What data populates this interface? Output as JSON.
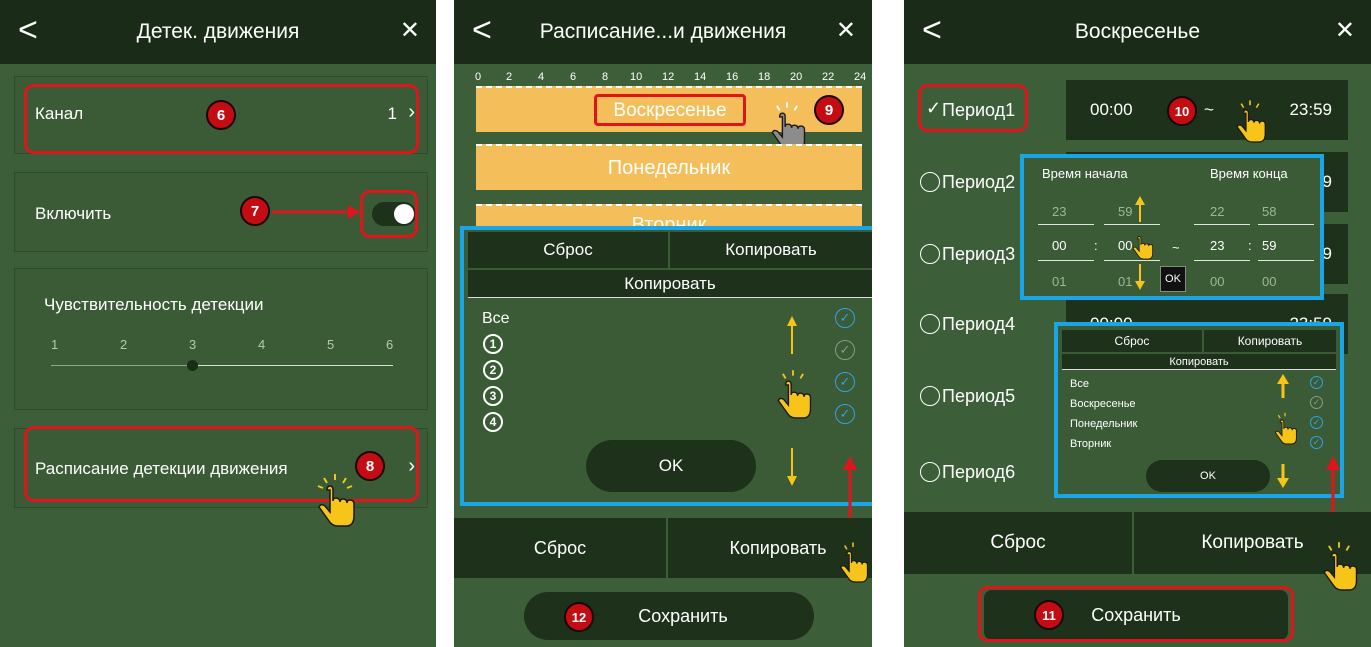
{
  "screen1": {
    "title": "Детек. движения",
    "channel_label": "Канал",
    "channel_value": "1",
    "enable_label": "Включить",
    "sensitivity_label": "Чувствительность детекции",
    "ticks": [
      "1",
      "2",
      "3",
      "4",
      "5",
      "6"
    ],
    "sensitivity": 3,
    "schedule_label": "Расписание детекции движения",
    "step6": "6",
    "step7": "7",
    "step8": "8"
  },
  "screen2": {
    "title": "Расписание...и движения",
    "hours": [
      "0",
      "2",
      "4",
      "6",
      "8",
      "10",
      "12",
      "14",
      "16",
      "18",
      "20",
      "22",
      "24"
    ],
    "days": [
      "Воскресенье",
      "Понедельник",
      "Вторник"
    ],
    "popup": {
      "reset": "Сброс",
      "copy": "Копировать",
      "header": "Копировать",
      "all": "Все",
      "items": [
        "1",
        "2",
        "3",
        "4"
      ],
      "ok": "OK"
    },
    "reset": "Сброс",
    "copy": "Копировать",
    "save": "Сохранить",
    "step9": "9",
    "step12": "12"
  },
  "screen3": {
    "title": "Воскресенье",
    "periods": [
      "Период1",
      "Период2",
      "Период3",
      "Период4",
      "Период5",
      "Период6"
    ],
    "p1_start": "00:00",
    "tilde": "~",
    "p1_end": "23:59",
    "partial": [
      "9",
      "9"
    ],
    "p4_partial_start": "00:00",
    "p4_partial_end": "23:59",
    "picker": {
      "start_label": "Время начала",
      "end_label": "Время конца",
      "rows": [
        [
          "23",
          "59",
          "22",
          "58"
        ],
        [
          "00",
          "00",
          "23",
          "59"
        ],
        [
          "01",
          "01",
          "00",
          "00"
        ]
      ],
      "ok": "OK"
    },
    "popup": {
      "reset": "Сброс",
      "copy": "Копировать",
      "header": "Копировать",
      "items": [
        "Все",
        "Воскресенье",
        "Понедельник",
        "Вторник"
      ],
      "ok": "OK"
    },
    "reset": "Сброс",
    "copy": "Копировать",
    "save": "Сохранить",
    "step10": "10",
    "step11": "11"
  },
  "colors": {
    "bg": "#3c5e38",
    "header": "#1a2c17",
    "red": "#e0141b",
    "blue": "#1aa6e6",
    "day_bar": "#f4bf5a",
    "arrow": "#f7c41a"
  }
}
